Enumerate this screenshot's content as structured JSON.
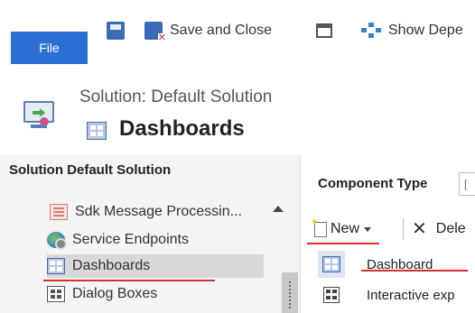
{
  "ribbon": {
    "file_label": "File",
    "save_icon": "save-icon",
    "save_close_label": "Save and Close",
    "print_icon": "print-icon",
    "show_dependencies_label": "Show Depe"
  },
  "header": {
    "solution_line": "Solution: Default Solution",
    "title": "Dashboards"
  },
  "nav": {
    "header": "Solution Default Solution",
    "items": [
      {
        "label": "Sdk Message Processin...",
        "icon": "sdk-message-icon"
      },
      {
        "label": "Service Endpoints",
        "icon": "service-endpoints-icon"
      },
      {
        "label": "Dashboards",
        "icon": "dashboards-icon",
        "selected": true
      },
      {
        "label": "Dialog Boxes",
        "icon": "dialog-boxes-icon"
      }
    ]
  },
  "main": {
    "component_type_label": "Component Type",
    "component_type_value": "[",
    "toolbar": {
      "new_label": "New",
      "delete_label": "Dele"
    },
    "rows": [
      {
        "label": "Dashboard",
        "icon": "dashboard-icon"
      },
      {
        "label": "Interactive exp",
        "icon": "interactive-experience-icon"
      }
    ]
  },
  "colors": {
    "file_button": "#2a6fd1",
    "selected_nav": "#d8d8d8",
    "highlight_underline": "#d9302b"
  }
}
